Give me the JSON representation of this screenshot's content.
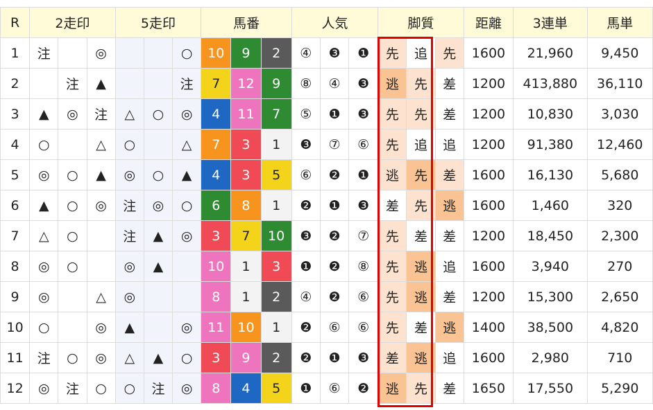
{
  "headers": {
    "race": "R",
    "mark2": "2走印",
    "mark5": "5走印",
    "horse_no": "馬番",
    "popularity": "人気",
    "style": "脚質",
    "distance": "距離",
    "trifecta": "3連単",
    "exacta": "馬単"
  },
  "colors": {
    "mark_red": "#e53030",
    "mark_blue": "#1f6fd1",
    "header_bg": "#fffbd8",
    "highlight_border": "#e00000",
    "style_sen_bg": "#fde3cf",
    "style_nige_bg": "#f9c393",
    "style_sashi_bg": "#fde3cf"
  },
  "num_colors": {
    "1": {
      "bg": "#f3f3f3",
      "fg": "#222222"
    },
    "2": {
      "bg": "#5a5a5a",
      "fg": "#ffffff"
    },
    "3": {
      "bg": "#ef4a55",
      "fg": "#ffffff"
    },
    "4": {
      "bg": "#1e68c4",
      "fg": "#ffffff"
    },
    "5": {
      "bg": "#f3d41a",
      "fg": "#222222"
    },
    "6": {
      "bg": "#2e8b32",
      "fg": "#ffffff"
    },
    "7": {
      "bg": "#f7941d",
      "fg": "#ffffff"
    },
    "8": {
      "bg": "#ee74bd",
      "fg": "#ffffff"
    },
    "9": {
      "bg": "#f7941d",
      "fg": "#ffffff"
    },
    "10": {
      "bg": "#f09330",
      "fg": "#ffffff"
    },
    "11": {
      "bg": "#ef4a55",
      "fg": "#ffffff"
    },
    "12": {
      "bg": "#ef4a55",
      "fg": "#ffffff"
    }
  },
  "rows": [
    {
      "r": "1",
      "m2": [
        "注",
        "",
        "◎"
      ],
      "m5": [
        "",
        "",
        "○"
      ],
      "nums": [
        {
          "n": "10",
          "bg": "#f7941d",
          "fg": "#ffffff"
        },
        {
          "n": "9",
          "bg": "#2e8b32",
          "fg": "#ffffff"
        },
        {
          "n": "2",
          "bg": "#5a5a5a",
          "fg": "#ffffff"
        }
      ],
      "pop": [
        "④",
        "❸",
        "❶"
      ],
      "style": [
        {
          "t": "先",
          "bg": "#fde3cf"
        },
        {
          "t": "追",
          "bg": "#ffffff"
        },
        {
          "t": "先",
          "bg": "#fde3cf"
        }
      ],
      "dist": "1600",
      "tri": "21,960",
      "exa": "9,450"
    },
    {
      "r": "2",
      "m2": [
        "",
        "注",
        "▲"
      ],
      "m5": [
        "",
        "",
        "注"
      ],
      "nums": [
        {
          "n": "7",
          "bg": "#f3d41a",
          "fg": "#222222"
        },
        {
          "n": "12",
          "bg": "#ee74bd",
          "fg": "#ffffff"
        },
        {
          "n": "9",
          "bg": "#2e8b32",
          "fg": "#ffffff"
        }
      ],
      "pop": [
        "⑧",
        "④",
        "❸"
      ],
      "style": [
        {
          "t": "逃",
          "bg": "#f9c393"
        },
        {
          "t": "先",
          "bg": "#fde3cf"
        },
        {
          "t": "差",
          "bg": "#ffffff"
        }
      ],
      "dist": "1200",
      "tri": "413,880",
      "exa": "36,110"
    },
    {
      "r": "3",
      "m2": [
        "▲",
        "◎",
        "注"
      ],
      "m5": [
        "△",
        "○",
        "◎"
      ],
      "nums": [
        {
          "n": "4",
          "bg": "#1e68c4",
          "fg": "#ffffff"
        },
        {
          "n": "11",
          "bg": "#ee74bd",
          "fg": "#ffffff"
        },
        {
          "n": "7",
          "bg": "#2e8b32",
          "fg": "#ffffff"
        }
      ],
      "pop": [
        "⑤",
        "❶",
        "❸"
      ],
      "style": [
        {
          "t": "先",
          "bg": "#fde3cf"
        },
        {
          "t": "先",
          "bg": "#fde3cf"
        },
        {
          "t": "差",
          "bg": "#ffffff"
        }
      ],
      "dist": "1200",
      "tri": "10,830",
      "exa": "3,030"
    },
    {
      "r": "4",
      "m2": [
        "○",
        "",
        "△"
      ],
      "m5": [
        "○",
        "",
        "△"
      ],
      "nums": [
        {
          "n": "7",
          "bg": "#f7941d",
          "fg": "#ffffff"
        },
        {
          "n": "3",
          "bg": "#ef4a55",
          "fg": "#ffffff"
        },
        {
          "n": "1",
          "bg": "#f3f3f3",
          "fg": "#222222"
        }
      ],
      "pop": [
        "❸",
        "⑦",
        "⑥"
      ],
      "style": [
        {
          "t": "先",
          "bg": "#fde3cf"
        },
        {
          "t": "追",
          "bg": "#ffffff"
        },
        {
          "t": "追",
          "bg": "#ffffff"
        }
      ],
      "dist": "1200",
      "tri": "91,380",
      "exa": "12,460"
    },
    {
      "r": "5",
      "m2": [
        "◎",
        "○",
        "▲"
      ],
      "m5": [
        "◎",
        "○",
        "▲"
      ],
      "nums": [
        {
          "n": "4",
          "bg": "#1e68c4",
          "fg": "#ffffff"
        },
        {
          "n": "3",
          "bg": "#ef4a55",
          "fg": "#ffffff"
        },
        {
          "n": "5",
          "bg": "#f3d41a",
          "fg": "#222222"
        }
      ],
      "pop": [
        "⑥",
        "❷",
        "❶"
      ],
      "style": [
        {
          "t": "逃",
          "bg": "#fde3cf"
        },
        {
          "t": "先",
          "bg": "#f9c393"
        },
        {
          "t": "差",
          "bg": "#fde3cf"
        }
      ],
      "dist": "1600",
      "tri": "16,130",
      "exa": "5,680"
    },
    {
      "r": "6",
      "m2": [
        "▲",
        "○",
        "◎"
      ],
      "m5": [
        "注",
        "◎",
        "○"
      ],
      "nums": [
        {
          "n": "6",
          "bg": "#2e8b32",
          "fg": "#ffffff"
        },
        {
          "n": "8",
          "bg": "#f7941d",
          "fg": "#ffffff"
        },
        {
          "n": "1",
          "bg": "#f3f3f3",
          "fg": "#222222"
        }
      ],
      "pop": [
        "❷",
        "❶",
        "❸"
      ],
      "style": [
        {
          "t": "差",
          "bg": "#ffffff"
        },
        {
          "t": "先",
          "bg": "#fde3cf"
        },
        {
          "t": "逃",
          "bg": "#f9c393"
        }
      ],
      "dist": "1600",
      "tri": "1,460",
      "exa": "320"
    },
    {
      "r": "7",
      "m2": [
        "△",
        "○",
        ""
      ],
      "m5": [
        "注",
        "▲",
        "◎"
      ],
      "nums": [
        {
          "n": "3",
          "bg": "#ef4a55",
          "fg": "#ffffff"
        },
        {
          "n": "7",
          "bg": "#f3d41a",
          "fg": "#222222"
        },
        {
          "n": "10",
          "bg": "#2e8b32",
          "fg": "#ffffff"
        }
      ],
      "pop": [
        "❸",
        "❷",
        "⑦"
      ],
      "style": [
        {
          "t": "先",
          "bg": "#fde3cf"
        },
        {
          "t": "差",
          "bg": "#ffffff"
        },
        {
          "t": "差",
          "bg": "#ffffff"
        }
      ],
      "dist": "1200",
      "tri": "18,450",
      "exa": "2,300"
    },
    {
      "r": "8",
      "m2": [
        "◎",
        "○",
        ""
      ],
      "m5": [
        "◎",
        "▲",
        ""
      ],
      "nums": [
        {
          "n": "10",
          "bg": "#ee74bd",
          "fg": "#ffffff"
        },
        {
          "n": "1",
          "bg": "#f3f3f3",
          "fg": "#222222"
        },
        {
          "n": "3",
          "bg": "#ef4a55",
          "fg": "#ffffff"
        }
      ],
      "pop": [
        "❶",
        "❷",
        "⑧"
      ],
      "style": [
        {
          "t": "先",
          "bg": "#fde3cf"
        },
        {
          "t": "逃",
          "bg": "#f9c393"
        },
        {
          "t": "追",
          "bg": "#ffffff"
        }
      ],
      "dist": "1600",
      "tri": "3,940",
      "exa": "270"
    },
    {
      "r": "9",
      "m2": [
        "◎",
        "",
        "△"
      ],
      "m5": [
        "◎",
        "",
        ""
      ],
      "nums": [
        {
          "n": "8",
          "bg": "#ee74bd",
          "fg": "#ffffff"
        },
        {
          "n": "1",
          "bg": "#f3f3f3",
          "fg": "#222222"
        },
        {
          "n": "2",
          "bg": "#5a5a5a",
          "fg": "#ffffff"
        }
      ],
      "pop": [
        "④",
        "❷",
        "⑥"
      ],
      "style": [
        {
          "t": "先",
          "bg": "#fde3cf"
        },
        {
          "t": "逃",
          "bg": "#f9c393"
        },
        {
          "t": "差",
          "bg": "#ffffff"
        }
      ],
      "dist": "1200",
      "tri": "15,300",
      "exa": "2,650"
    },
    {
      "r": "10",
      "m2": [
        "○",
        "",
        "◎"
      ],
      "m5": [
        "▲",
        "",
        "◎"
      ],
      "nums": [
        {
          "n": "11",
          "bg": "#ee74bd",
          "fg": "#ffffff"
        },
        {
          "n": "10",
          "bg": "#f7941d",
          "fg": "#ffffff"
        },
        {
          "n": "1",
          "bg": "#f3f3f3",
          "fg": "#222222"
        }
      ],
      "pop": [
        "❷",
        "⑥",
        "⑥"
      ],
      "style": [
        {
          "t": "先",
          "bg": "#fde3cf"
        },
        {
          "t": "差",
          "bg": "#ffffff"
        },
        {
          "t": "逃",
          "bg": "#f9c393"
        }
      ],
      "dist": "1400",
      "tri": "38,500",
      "exa": "4,820"
    },
    {
      "r": "11",
      "m2": [
        "注",
        "○",
        "◎"
      ],
      "m5": [
        "△",
        "▲",
        "○"
      ],
      "nums": [
        {
          "n": "3",
          "bg": "#ef4a55",
          "fg": "#ffffff"
        },
        {
          "n": "9",
          "bg": "#ee74bd",
          "fg": "#ffffff"
        },
        {
          "n": "2",
          "bg": "#5a5a5a",
          "fg": "#ffffff"
        }
      ],
      "pop": [
        "❷",
        "❶",
        "❸"
      ],
      "style": [
        {
          "t": "差",
          "bg": "#fde3cf"
        },
        {
          "t": "逃",
          "bg": "#f9c393"
        },
        {
          "t": "追",
          "bg": "#ffffff"
        }
      ],
      "dist": "1600",
      "tri": "2,980",
      "exa": "710"
    },
    {
      "r": "12",
      "m2": [
        "◎",
        "注",
        "○"
      ],
      "m5": [
        "○",
        "注",
        "◎"
      ],
      "nums": [
        {
          "n": "8",
          "bg": "#ee74bd",
          "fg": "#ffffff"
        },
        {
          "n": "4",
          "bg": "#1e68c4",
          "fg": "#ffffff"
        },
        {
          "n": "5",
          "bg": "#f3d41a",
          "fg": "#222222"
        }
      ],
      "pop": [
        "❶",
        "⑥",
        "❷"
      ],
      "style": [
        {
          "t": "逃",
          "bg": "#f9c393"
        },
        {
          "t": "先",
          "bg": "#fde3cf"
        },
        {
          "t": "差",
          "bg": "#ffffff"
        }
      ],
      "dist": "1650",
      "tri": "17,550",
      "exa": "5,290"
    }
  ]
}
